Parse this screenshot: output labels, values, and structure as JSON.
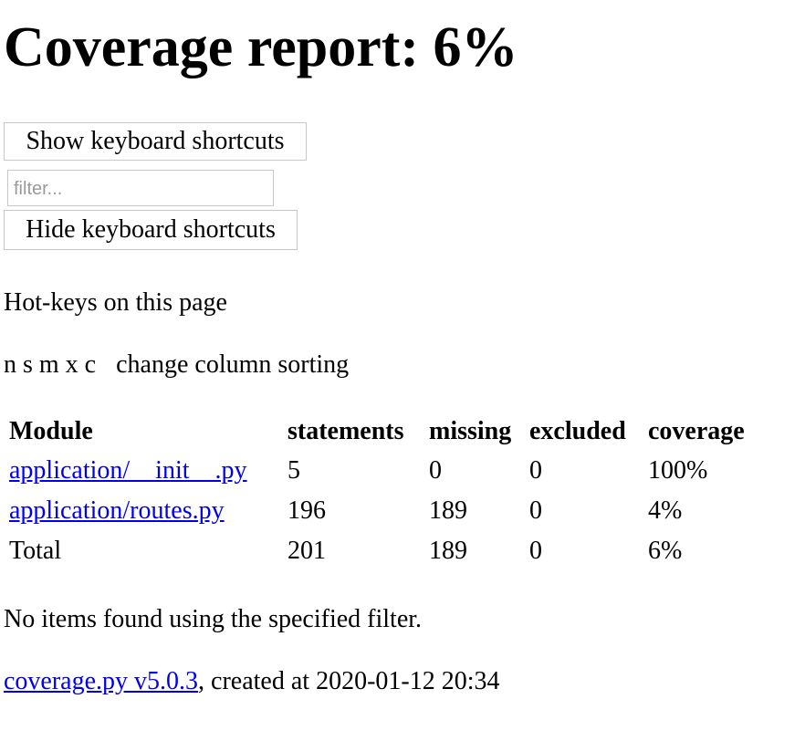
{
  "header": {
    "title": "Coverage report: 6%"
  },
  "controls": {
    "show_shortcuts_label": "Show keyboard shortcuts",
    "filter_placeholder": "filter...",
    "filter_value": "",
    "hide_shortcuts_label": "Hide keyboard shortcuts"
  },
  "hotkeys": {
    "heading": "Hot-keys on this page",
    "keys": "n s m x c",
    "description": "change column sorting"
  },
  "table": {
    "columns": [
      "Module",
      "statements",
      "missing",
      "excluded",
      "coverage"
    ],
    "rows": [
      {
        "module": "application/__init__.py",
        "statements": "5",
        "missing": "0",
        "excluded": "0",
        "coverage": "100%"
      },
      {
        "module": "application/routes.py",
        "statements": "196",
        "missing": "189",
        "excluded": "0",
        "coverage": "4%"
      }
    ],
    "total": {
      "module": "Total",
      "statements": "201",
      "missing": "189",
      "excluded": "0",
      "coverage": "6%"
    }
  },
  "messages": {
    "no_items": "No items found using the specified filter."
  },
  "footer": {
    "link_text": "coverage.py v5.0.3",
    "created_text": ", created at 2020-01-12 20:34"
  }
}
